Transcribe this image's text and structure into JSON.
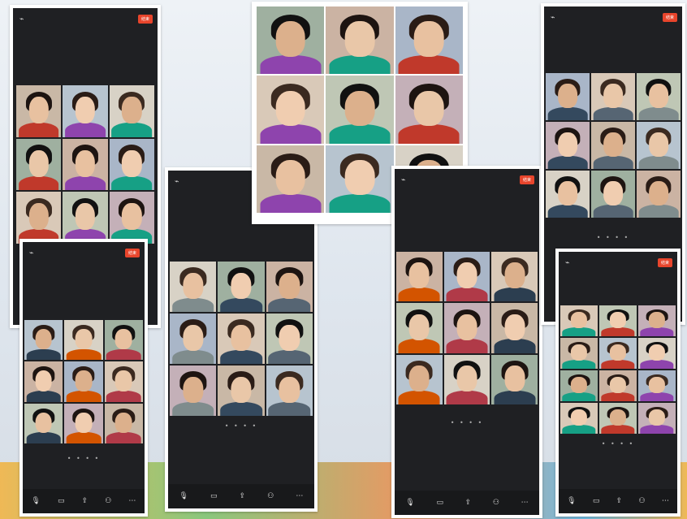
{
  "scene": {
    "description_colors": {
      "wall": "#dfe6ee",
      "end_button": "#e8452c",
      "screen_bg": "#1f2023"
    }
  },
  "phones": [
    {
      "id": "p1",
      "topbar": {
        "title": "",
        "subtitle": "",
        "end": "结束"
      },
      "tiles": [
        "",
        "",
        "",
        "",
        "",
        "",
        "",
        "",
        ""
      ]
    },
    {
      "id": "p2",
      "topbar": {
        "title": "",
        "subtitle": "",
        "end": "结束"
      },
      "tiles": [
        "",
        "",
        "",
        "",
        "",
        "",
        "",
        "",
        ""
      ]
    },
    {
      "id": "p3",
      "topbar": {
        "title": "",
        "subtitle": "",
        "end": ""
      },
      "tiles": [
        "",
        "",
        "",
        "",
        "",
        "",
        "",
        "",
        ""
      ],
      "avatar_label": ""
    },
    {
      "id": "p4",
      "topbar": {
        "title": "",
        "subtitle": "",
        "end": ""
      },
      "tiles": [
        "",
        "",
        "",
        "",
        "",
        "",
        "",
        "",
        "",
        "",
        "",
        "",
        "",
        "",
        "",
        "",
        "",
        "",
        "",
        "",
        ""
      ]
    },
    {
      "id": "p5",
      "topbar": {
        "title": "",
        "subtitle": "",
        "end": "结束"
      },
      "tiles": [
        "",
        "",
        "",
        "",
        "",
        "",
        "",
        "",
        ""
      ]
    },
    {
      "id": "p6",
      "topbar": {
        "title": "",
        "subtitle": "",
        "end": "结束"
      },
      "tiles": [
        "",
        "",
        "",
        "",
        "",
        "",
        "",
        "",
        "",
        "",
        ""
      ]
    },
    {
      "id": "p7",
      "topbar": {
        "title": "",
        "subtitle": "",
        "end": "结束"
      },
      "tiles": [
        "",
        "",
        "",
        "",
        "",
        "",
        "",
        "",
        "",
        "",
        "",
        ""
      ],
      "avatar_label": ""
    }
  ],
  "toolbar_items": [
    "",
    "",
    "",
    "",
    ""
  ],
  "page_dots": "• • • •"
}
